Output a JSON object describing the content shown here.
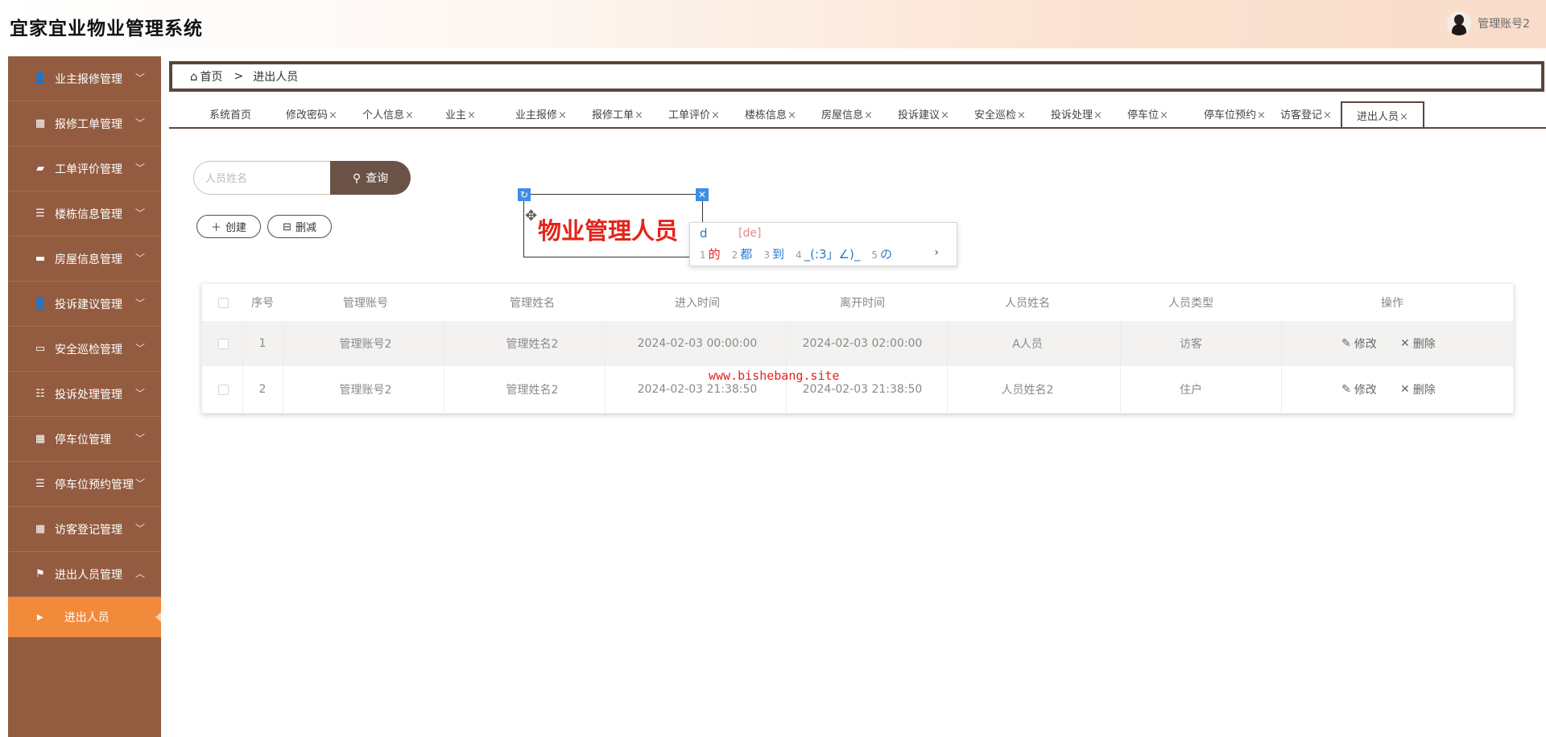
{
  "header": {
    "title": "宜家宜业物业管理系统",
    "user_name": "管理账号2"
  },
  "sidebar": {
    "items": [
      {
        "label": "业主报修管理",
        "icon": "user-icon",
        "chev": "﹀"
      },
      {
        "label": "报修工单管理",
        "icon": "grid-icon",
        "chev": "﹀"
      },
      {
        "label": "工单评价管理",
        "icon": "ticket-icon",
        "chev": "﹀"
      },
      {
        "label": "楼栋信息管理",
        "icon": "list-icon",
        "chev": "﹀"
      },
      {
        "label": "房屋信息管理",
        "icon": "card-icon",
        "chev": "﹀"
      },
      {
        "label": "投诉建议管理",
        "icon": "user-icon",
        "chev": "﹀"
      },
      {
        "label": "安全巡检管理",
        "icon": "monitor-icon",
        "chev": "﹀"
      },
      {
        "label": "投诉处理管理",
        "icon": "sliders-icon",
        "chev": "﹀"
      },
      {
        "label": "停车位管理",
        "icon": "grid-icon",
        "chev": "﹀"
      },
      {
        "label": "停车位预约管理",
        "icon": "list-icon",
        "chev": "﹀"
      },
      {
        "label": "访客登记管理",
        "icon": "grid-icon",
        "chev": "﹀"
      },
      {
        "label": "进出人员管理",
        "icon": "flag-icon",
        "chev": "︿"
      }
    ],
    "sub_item": "进出人员"
  },
  "breadcrumb": {
    "home": "首页",
    "separator": ">",
    "current": "进出人员"
  },
  "tabs": [
    {
      "label": "系统首页",
      "closable": false
    },
    {
      "label": "修改密码",
      "closable": true
    },
    {
      "label": "个人信息",
      "closable": true
    },
    {
      "label": "业主",
      "closable": true
    },
    {
      "label": "业主报修",
      "closable": true
    },
    {
      "label": "报修工单",
      "closable": true
    },
    {
      "label": "工单评价",
      "closable": true
    },
    {
      "label": "楼栋信息",
      "closable": true
    },
    {
      "label": "房屋信息",
      "closable": true
    },
    {
      "label": "投诉建议",
      "closable": true
    },
    {
      "label": "安全巡检",
      "closable": true
    },
    {
      "label": "投诉处理",
      "closable": true
    },
    {
      "label": "停车位",
      "closable": true
    },
    {
      "label": "停车位预约",
      "closable": true
    },
    {
      "label": "访客登记",
      "closable": true
    },
    {
      "label": "进出人员",
      "closable": true,
      "active": true
    }
  ],
  "search": {
    "placeholder": "人员姓名",
    "button": "查询"
  },
  "actions": {
    "create": "创建",
    "delete": "删减"
  },
  "editor": {
    "text": "物业管理人员",
    "ime_composition": "d",
    "ime_pinyin": "[de]",
    "candidates": [
      {
        "n": "1",
        "text": "的"
      },
      {
        "n": "2",
        "text": "都"
      },
      {
        "n": "3",
        "text": "到"
      },
      {
        "n": "4",
        "text": "_(:3」∠)_"
      },
      {
        "n": "5",
        "text": "の"
      }
    ],
    "next": "›"
  },
  "table": {
    "columns": [
      "序号",
      "管理账号",
      "管理姓名",
      "进入时间",
      "离开时间",
      "人员姓名",
      "人员类型",
      "操作"
    ],
    "rows": [
      {
        "no": "1",
        "account": "管理账号2",
        "manager": "管理姓名2",
        "enter": "2024-02-03 00:00:00",
        "leave": "2024-02-03 02:00:00",
        "person": "A人员",
        "type": "访客"
      },
      {
        "no": "2",
        "account": "管理账号2",
        "manager": "管理姓名2",
        "enter": "2024-02-03 21:38:50",
        "leave": "2024-02-03 21:38:50",
        "person": "人员姓名2",
        "type": "住户"
      }
    ],
    "edit_label": "修改",
    "delete_label": "删除"
  },
  "watermark": "www.bishebang.site",
  "colors": {
    "sidebar": "#935c40",
    "active": "#f28a3c",
    "accent": "#5a463c",
    "highlight": "#e3241c"
  }
}
